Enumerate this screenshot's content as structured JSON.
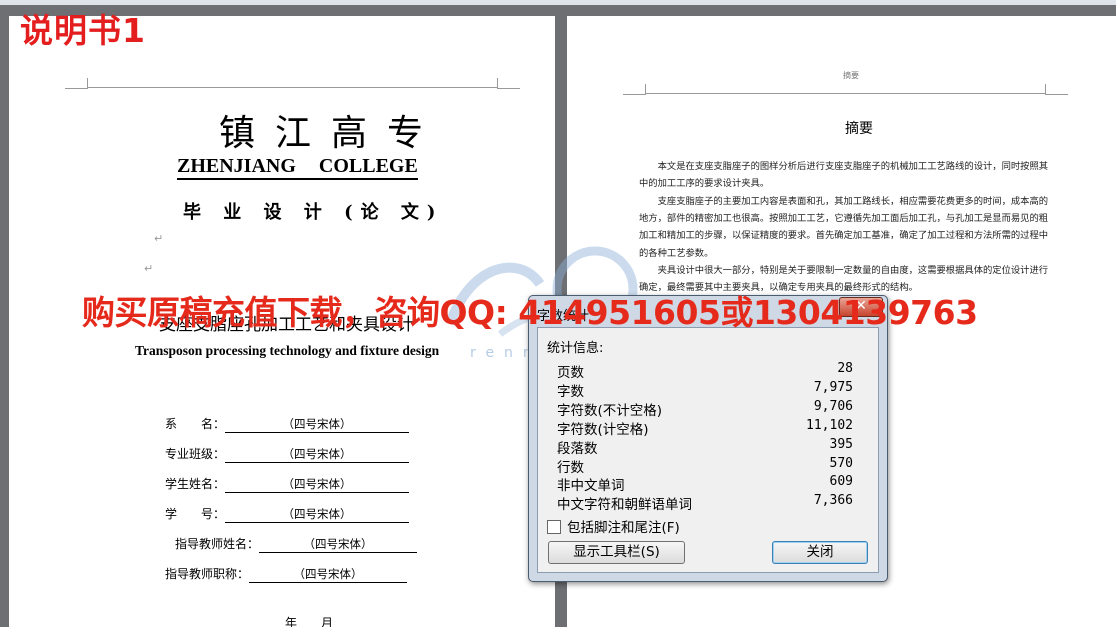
{
  "label_red": "说明书1",
  "left_page": {
    "school_cn": "镇江高专",
    "school_en": "ZHENJIANG COLLEGE",
    "subtitle": "毕 业 设 计 (论 文)",
    "topic_cn": "支座支脂座孔加工工艺和夹具设计",
    "topic_en": "Transposon processing technology and fixture design",
    "fields": [
      {
        "label": "系　　名：",
        "value": "（四号宋体）"
      },
      {
        "label": "专业班级：",
        "value": "（四号宋体）"
      },
      {
        "label": "学生姓名：",
        "value": "（四号宋体）"
      },
      {
        "label": "学　　号：",
        "value": "（四号宋体）"
      },
      {
        "label": "指导教师姓名：",
        "value": "（四号宋体）"
      },
      {
        "label": "指导教师职称：",
        "value": "（四号宋体）"
      }
    ],
    "date": "年　　月"
  },
  "right_page": {
    "header": "摘要",
    "title": "摘要",
    "paragraphs": [
      "本文是在支座支脂座子的图样分析后进行支座支脂座子的机械加工工艺路线的设计，同时按照其中的加工工序的要求设计夹具。",
      "支座支脂座子的主要加工内容是表面和孔，其加工路线长，相应需要花费更多的时间，成本高的地方，部件的精密加工也很高。按照加工工艺，它遵循先加工面后加工孔，与孔加工是显而易见的粗加工和精加工的步骤，以保证精度的要求。首先确定加工基准，确定了加工过程和方法所需的过程中的各种工艺参数。",
      "夹具设计中很大一部分，特别是关于要限制一定数量的自由度，这需要根据具体的定位设计进行确定，最终需要其中主要夹具，以确定专用夹具的最终形式的结构。"
    ]
  },
  "overlay_ad": "购买原稿充值下载，咨询QQ: 414951605或1304139763",
  "watermark": "renrendoc.com",
  "dialog": {
    "title": "字数统计",
    "close_glyph": "✕",
    "stats_label": "统计信息:",
    "stats": [
      {
        "key": "页数",
        "value": "28"
      },
      {
        "key": "字数",
        "value": "7,975"
      },
      {
        "key": "字符数(不计空格)",
        "value": "9,706"
      },
      {
        "key": "字符数(计空格)",
        "value": "11,102"
      },
      {
        "key": "段落数",
        "value": "395"
      },
      {
        "key": "行数",
        "value": "570"
      },
      {
        "key": "非中文单词",
        "value": "609"
      },
      {
        "key": "中文字符和朝鲜语单词",
        "value": "7,366"
      }
    ],
    "checkbox_label": "包括脚注和尾注(F)",
    "show_toolbar_button": "显示工具栏(S)",
    "close_button": "关闭"
  },
  "colors": {
    "red": "#e52a1c",
    "dialog_bg": "#cfd9e6",
    "gray_bg": "#6d6f73"
  }
}
